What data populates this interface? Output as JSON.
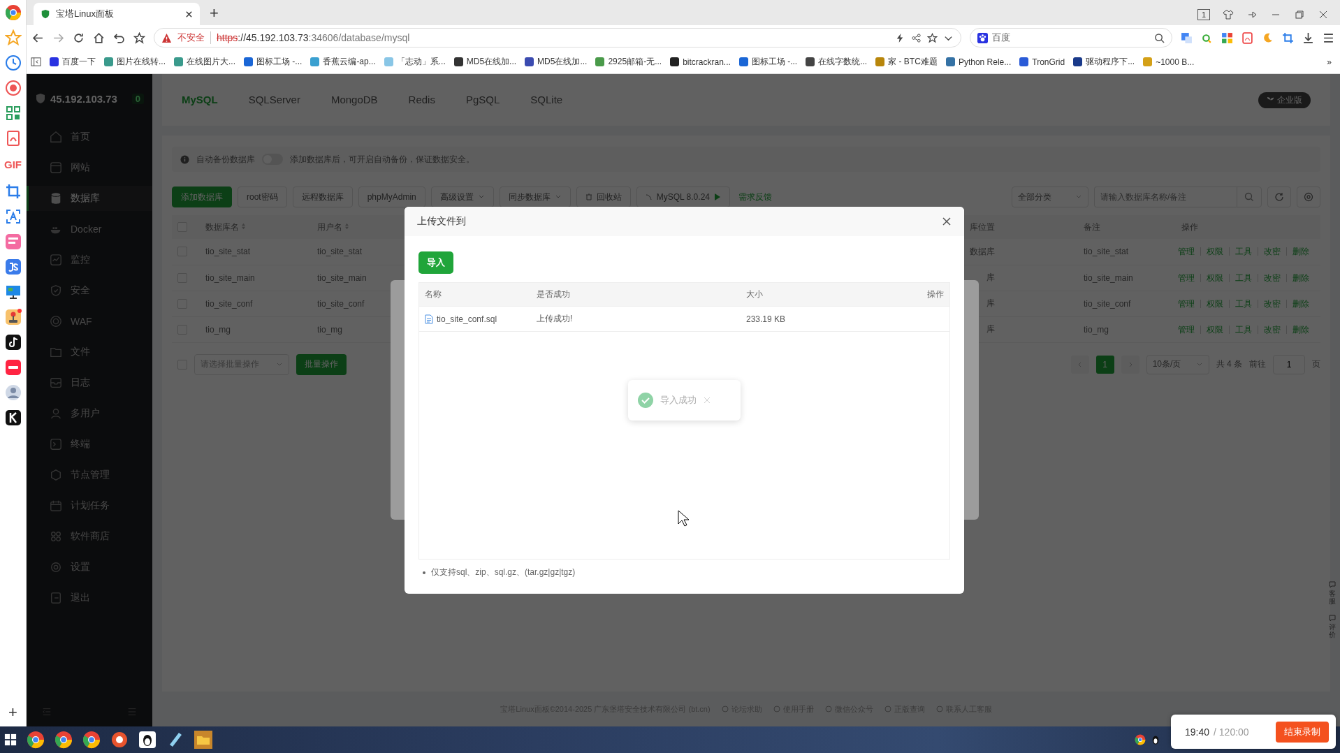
{
  "browser": {
    "tabs": [
      {
        "title": "宝塔Linux面板",
        "selected": true
      }
    ],
    "new_tab": "+",
    "security_label": "不安全",
    "url": {
      "scheme": "https",
      "host": "://45.192.103.73",
      "path": ":34606/database/mysql"
    },
    "search_engine": "百度",
    "tab_count": "1",
    "bookmarks": [
      "百度一下",
      "图片在线转...",
      "在线图片大...",
      "图标工场 -...",
      "香蕉云编-ap...",
      "「志动」系...",
      "MD5在线加...",
      "MD5在线加...",
      "2925邮箱-无...",
      "bitcrackran...",
      "图标工场 -...",
      "在线字数统...",
      "家 - BTC难题",
      "Python Rele...",
      "TronGrid",
      "驱动程序下...",
      "~1000 B..."
    ],
    "bookmarks_more": "»"
  },
  "side_strip": {
    "gif_label": "GIF",
    "add": "+"
  },
  "panel": {
    "host": "45.192.103.73",
    "alert_count": "0",
    "nav": [
      {
        "label": "首页",
        "selected": false
      },
      {
        "label": "网站",
        "selected": false
      },
      {
        "label": "数据库",
        "selected": true
      },
      {
        "label": "Docker",
        "selected": false
      },
      {
        "label": "监控",
        "selected": false
      },
      {
        "label": "安全",
        "selected": false
      },
      {
        "label": "WAF",
        "selected": false
      },
      {
        "label": "文件",
        "selected": false
      },
      {
        "label": "日志",
        "selected": false
      },
      {
        "label": "多用户",
        "selected": false
      },
      {
        "label": "终端",
        "selected": false
      },
      {
        "label": "节点管理",
        "selected": false
      },
      {
        "label": "计划任务",
        "selected": false
      },
      {
        "label": "软件商店",
        "selected": false
      },
      {
        "label": "设置",
        "selected": false
      },
      {
        "label": "退出",
        "selected": false
      }
    ]
  },
  "db_tabs": [
    {
      "label": "MySQL",
      "selected": true
    },
    {
      "label": "SQLServer",
      "selected": false
    },
    {
      "label": "MongoDB",
      "selected": false
    },
    {
      "label": "Redis",
      "selected": false
    },
    {
      "label": "PgSQL",
      "selected": false
    },
    {
      "label": "SQLite",
      "selected": false
    }
  ],
  "edition_badge": "企业版",
  "notice": {
    "label": "自动备份数据库",
    "toggle_on": false,
    "hint": "添加数据库后，可开启自动备份，保证数据安全。"
  },
  "toolbar": [
    {
      "kind": "primary",
      "label": "添加数据库"
    },
    {
      "kind": "plain",
      "label": "root密码"
    },
    {
      "kind": "plain",
      "label": "远程数据库"
    },
    {
      "kind": "plain",
      "label": "phpMyAdmin"
    },
    {
      "kind": "dropdown",
      "label": "高级设置"
    },
    {
      "kind": "dropdown",
      "label": "同步数据库"
    },
    {
      "kind": "trash",
      "label": "回收站"
    },
    {
      "kind": "version",
      "label": "MySQL 8.0.24"
    },
    {
      "kind": "link",
      "label": "需求反馈"
    }
  ],
  "filters": {
    "category": "全部分类",
    "search_placeholder": "请输入数据库名称/备注"
  },
  "table": {
    "select_all_checked": false,
    "columns": [
      "数据库名",
      "用户名",
      "库位置",
      "备注",
      "操作"
    ],
    "rows": [
      {
        "checked": false,
        "name": "tio_site_stat",
        "user": "tio_site_stat",
        "location": "数据库",
        "remark": "tio_site_stat",
        "actions": [
          "管理",
          "权限",
          "工具",
          "改密",
          "删除"
        ]
      },
      {
        "checked": false,
        "name": "tio_site_main",
        "user": "tio_site_main",
        "location": "库",
        "remark": "tio_site_main",
        "actions": [
          "管理",
          "权限",
          "工具",
          "改密",
          "删除"
        ]
      },
      {
        "checked": false,
        "name": "tio_site_conf",
        "user": "tio_site_conf",
        "location": "库",
        "remark": "tio_site_conf",
        "actions": [
          "管理",
          "权限",
          "工具",
          "改密",
          "删除"
        ]
      },
      {
        "checked": false,
        "name": "tio_mg",
        "user": "tio_mg",
        "location": "库",
        "remark": "tio_mg",
        "actions": [
          "管理",
          "权限",
          "工具",
          "改密",
          "删除"
        ]
      }
    ]
  },
  "batch": {
    "checked": false,
    "placeholder": "请选择批量操作",
    "button": "批量操作"
  },
  "pagination": {
    "pages": [
      {
        "label": "1",
        "selected": true
      }
    ],
    "page_size": "10条/页",
    "total": "共 4 条",
    "goto": "前往",
    "goto_value": "1",
    "page_unit": "页"
  },
  "footer": {
    "copyright": "宝塔Linux面板©2014-2025 广东堡塔安全技术有限公司 (bt.cn)",
    "links": [
      "论坛求助",
      "使用手册",
      "微信公众号",
      "正版查询",
      "联系人工客服"
    ]
  },
  "float_tabs": [
    "客服",
    "评价"
  ],
  "dialog": {
    "title": "上传文件到",
    "import_button": "导入",
    "columns": [
      "名称",
      "是否成功",
      "大小",
      "操作"
    ],
    "files": [
      {
        "name": "tio_site_conf.sql",
        "status": "上传成功!",
        "size": "233.19 KB"
      }
    ],
    "note": "仅支持sql、zip、sql.gz、(tar.gz|gz|tgz)"
  },
  "toast": {
    "message": "导入成功"
  },
  "recorder": {
    "elapsed": "19:40",
    "limit": "/ 120:00",
    "stop_button": "结束录制"
  }
}
